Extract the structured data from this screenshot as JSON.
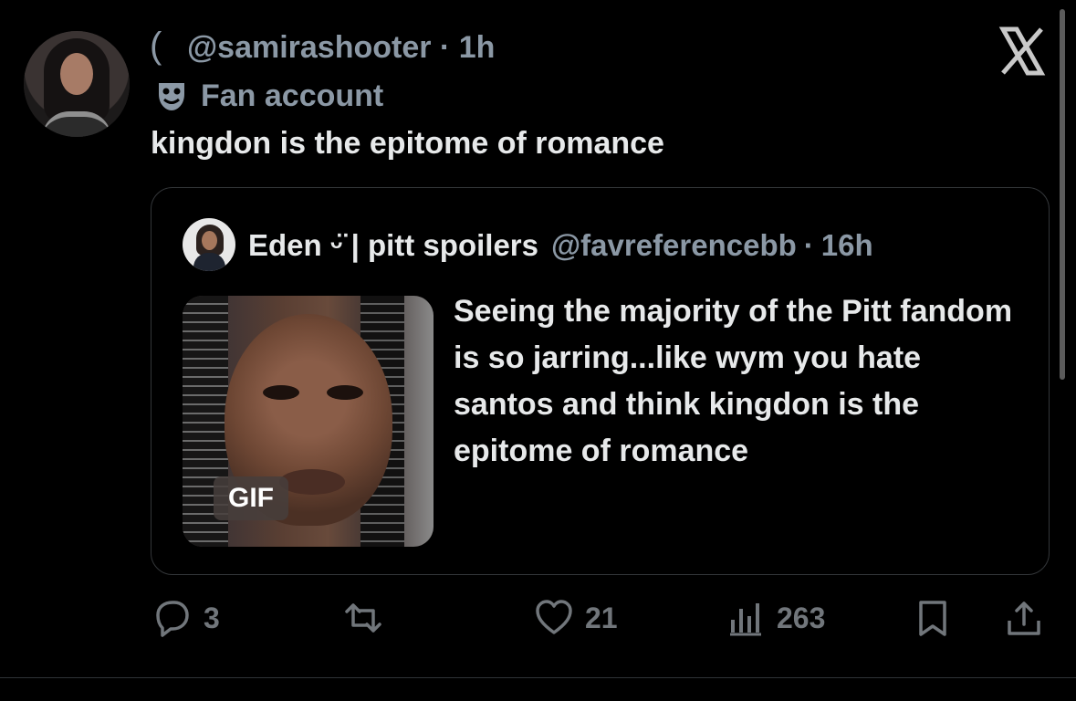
{
  "post": {
    "handle": "@samirashooter",
    "separator": "·",
    "time": "1h",
    "label": "Fan account",
    "text": "kingdon is the epitome of romance",
    "icons": {
      "close": "x-logo-icon",
      "label": "theater-mask-icon"
    }
  },
  "quote": {
    "display_name": "Eden ᵕ̈ | pitt spoilers",
    "handle": "@favreferencebb",
    "separator": "·",
    "time": "16h",
    "text": "Seeing the majority of the Pitt fandom is so jarring...like wym you hate santos and think kingdon is the epitome of romance",
    "media_badge": "GIF"
  },
  "actions": {
    "replies": "3",
    "reposts": "",
    "likes": "21",
    "views": "263"
  },
  "colors": {
    "background": "#000000",
    "text": "#e7e9ea",
    "muted": "#71767b"
  }
}
